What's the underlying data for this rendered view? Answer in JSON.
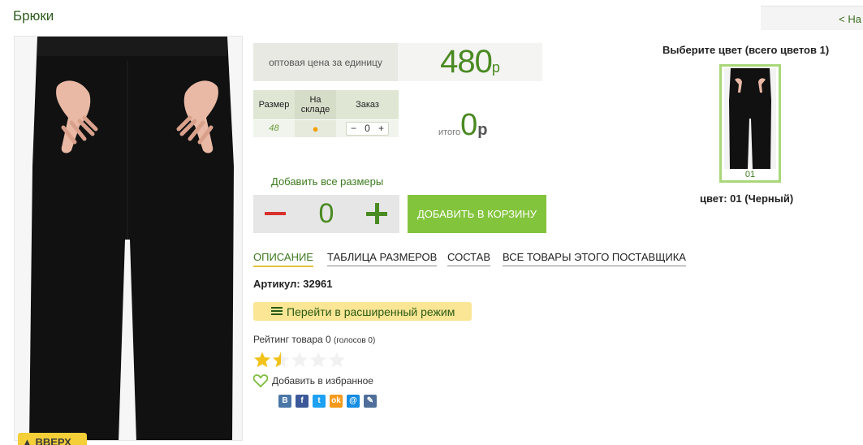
{
  "header": {
    "title": "Брюки",
    "back_link": "< На"
  },
  "photo": {
    "up_button": "▲ ВВЕРХ"
  },
  "price": {
    "label": "оптовая цена за единицу",
    "value": "480",
    "unit": "р"
  },
  "size_table": {
    "headers": [
      "Размер",
      "На складе",
      "Заказ"
    ],
    "rows": [
      {
        "size": "48",
        "stock": "●",
        "qty": "0",
        "minus": "−",
        "plus": "+"
      }
    ]
  },
  "total": {
    "label": "итого",
    "value": "0",
    "unit": "р"
  },
  "add_all_label": "Добавить все размеры",
  "stepper": {
    "value": "0"
  },
  "cart_button": "ДОБАВИТЬ В КОРЗИНУ",
  "tabs": [
    {
      "label": "ОПИСАНИЕ",
      "active": true
    },
    {
      "label": "ТАБЛИЦА РАЗМЕРОВ",
      "active": false
    },
    {
      "label": "СОСТАВ",
      "active": false
    },
    {
      "label": "ВСЕ ТОВАРЫ ЭТОГО ПОСТАВЩИКА",
      "active": false
    }
  ],
  "article": "Артикул: 32961",
  "advanced_mode_button": "Перейти в расширенный режим",
  "rating": {
    "label": "Рейтинг товара 0",
    "votes": "(голосов 0)",
    "stars_filled": 1.5,
    "stars_total": 5
  },
  "favorite_label": "Добавить в избранное",
  "social": [
    {
      "icon": "vk-icon",
      "glyph": "В",
      "color": "#4a76a8"
    },
    {
      "icon": "facebook-icon",
      "glyph": "f",
      "color": "#3b5998"
    },
    {
      "icon": "twitter-icon",
      "glyph": "t",
      "color": "#1da1f2"
    },
    {
      "icon": "odnoklassniki-icon",
      "glyph": "ok",
      "color": "#f59a1d"
    },
    {
      "icon": "mailru-icon",
      "glyph": "@",
      "color": "#168de2"
    },
    {
      "icon": "livejournal-icon",
      "glyph": "✎",
      "color": "#4f6f9a"
    }
  ],
  "colors": {
    "title": "Выберите цвет (всего цветов 1)",
    "swatch_code": "01",
    "selected_label": "цвет: 01 (Черный)"
  },
  "theme": {
    "accent_green": "#4a8a22",
    "cart_green": "#83c43d",
    "tab_underline": "#e6c23a",
    "minus_red": "#d8302c"
  }
}
